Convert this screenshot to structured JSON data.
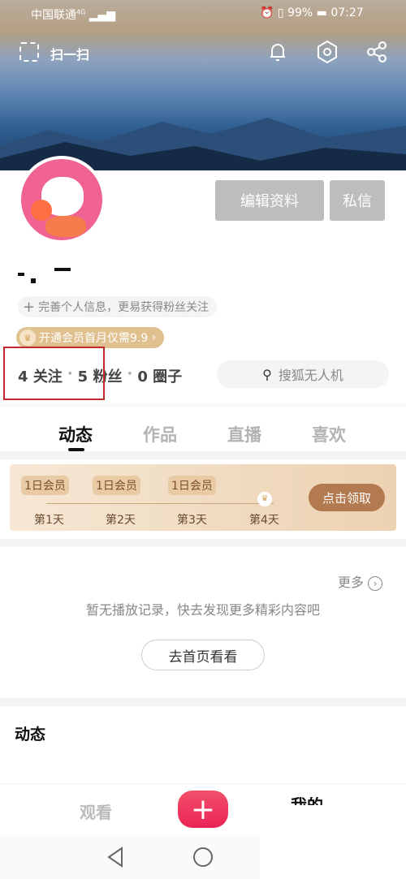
{
  "status_bar": {
    "carrier": "中国联通",
    "network": "4G",
    "battery": "99%",
    "time": "07:27"
  },
  "header": {
    "scan_label": "扫一扫",
    "icons": [
      "scan-icon",
      "bell-icon",
      "settings-hex-icon",
      "share-icon"
    ]
  },
  "profile": {
    "edit_label": "编辑资料",
    "message_label": "私信",
    "complete_info": "完善个人信息，更易获得粉丝关注",
    "vip_promo": "开通会员首月仅需9.9",
    "stats": [
      {
        "count": "4",
        "label": "关注"
      },
      {
        "count": "5",
        "label": "粉丝"
      },
      {
        "count": "0",
        "label": "圈子"
      }
    ],
    "search_placeholder": "搜狐无人机"
  },
  "tabs": [
    {
      "label": "动态",
      "active": true
    },
    {
      "label": "作品"
    },
    {
      "label": "直播"
    },
    {
      "label": "喜欢"
    }
  ],
  "checkin": {
    "days": [
      {
        "reward": "1日会员",
        "day": "第1天"
      },
      {
        "reward": "1日会员",
        "day": "第2天"
      },
      {
        "reward": "1日会员",
        "day": "第3天"
      },
      {
        "reward": "",
        "day": "第4天"
      }
    ],
    "claim_label": "点击领取"
  },
  "history": {
    "more_label": "更多",
    "empty_text": "暂无播放记录，快去发现更多精彩内容吧",
    "home_button": "去首页看看"
  },
  "feed_title": "动态",
  "bottom_nav": {
    "watch": "观看",
    "mine": "我的"
  },
  "colors": {
    "accent": "#f2385a",
    "highlight": "#c0282e",
    "gold": "#d9b27c"
  }
}
